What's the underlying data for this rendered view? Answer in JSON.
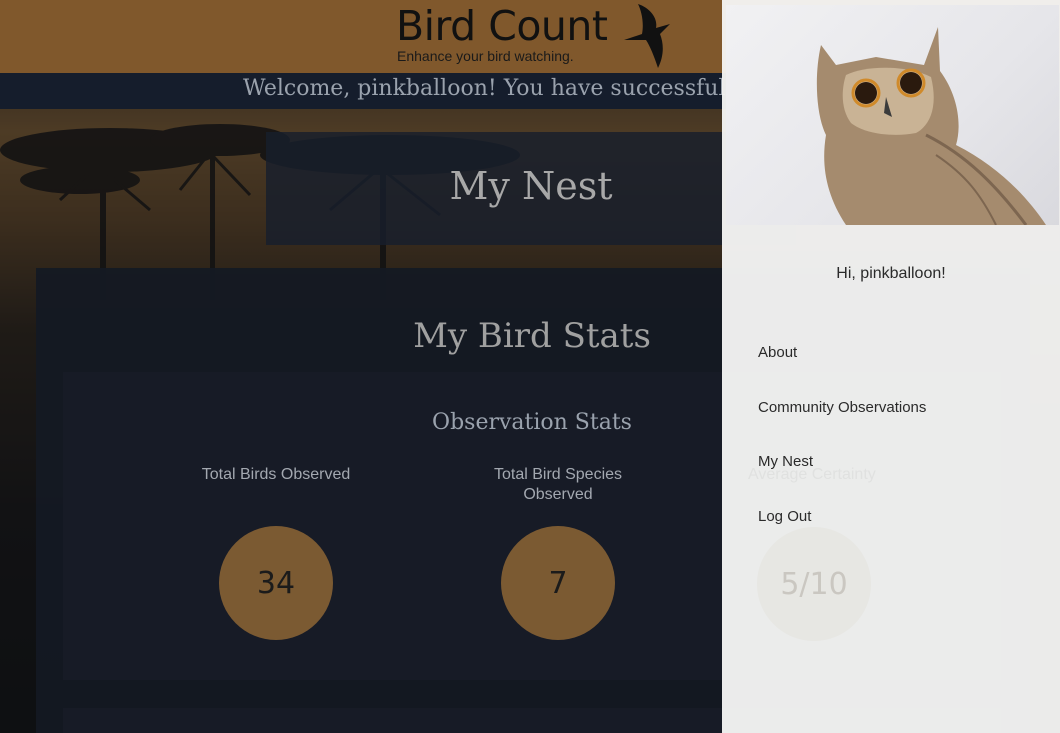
{
  "header": {
    "title": "Bird Count",
    "tagline": "Enhance your bird watching.",
    "logo_icon": "swift-bird-icon"
  },
  "welcome": {
    "text": "Welcome, pinkballoon! You have successfully logged in."
  },
  "page": {
    "title": "My Nest"
  },
  "stats": {
    "title": "My Bird Stats",
    "observation": {
      "title": "Observation Stats",
      "items": [
        {
          "label": "Total Birds Observed",
          "value": "34"
        },
        {
          "label": "Total Bird Species Observed",
          "value": "7"
        },
        {
          "label": "Average Certainty",
          "value": "5/10"
        }
      ]
    }
  },
  "drawer": {
    "greeting": "Hi, pinkballoon!",
    "nav": [
      {
        "label": "About"
      },
      {
        "label": "Community Observations"
      },
      {
        "label": "My Nest"
      },
      {
        "label": "Log Out"
      }
    ]
  },
  "colors": {
    "header_bg": "#80582c",
    "accent_circle": "#7b5a32",
    "panel_bg": "#171b26",
    "drawer_bg": "#f4f4f3"
  }
}
